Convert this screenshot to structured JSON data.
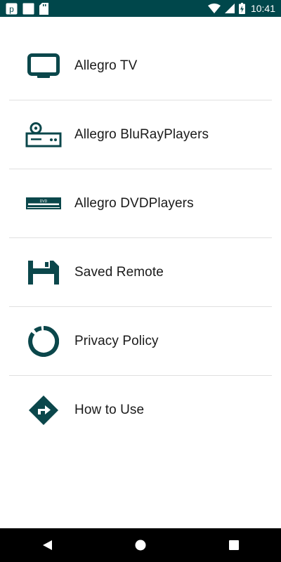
{
  "status_bar": {
    "time": "10:41",
    "icons": [
      "notification-p-icon",
      "blank-notification-icon",
      "sd-card-icon",
      "wifi-icon",
      "cell-signal-icon",
      "battery-charging-icon"
    ]
  },
  "menu": {
    "items": [
      {
        "label": "Allegro TV",
        "icon": "tv-icon"
      },
      {
        "label": "Allegro BluRayPlayers",
        "icon": "bluray-player-icon"
      },
      {
        "label": "Allegro DVDPlayers",
        "icon": "dvd-player-icon"
      },
      {
        "label": "Saved Remote",
        "icon": "save-icon"
      },
      {
        "label": "Privacy Policy",
        "icon": "privacy-ring-icon"
      },
      {
        "label": "How to Use",
        "icon": "directions-icon"
      }
    ]
  },
  "nav_bar": {
    "icons": [
      "back-icon",
      "home-icon",
      "recents-icon"
    ]
  },
  "colors": {
    "status_bar_bg": "#00474b",
    "icon_color": "#0b474b",
    "text": "#1a1a1a",
    "divider": "#e0e0e0"
  }
}
